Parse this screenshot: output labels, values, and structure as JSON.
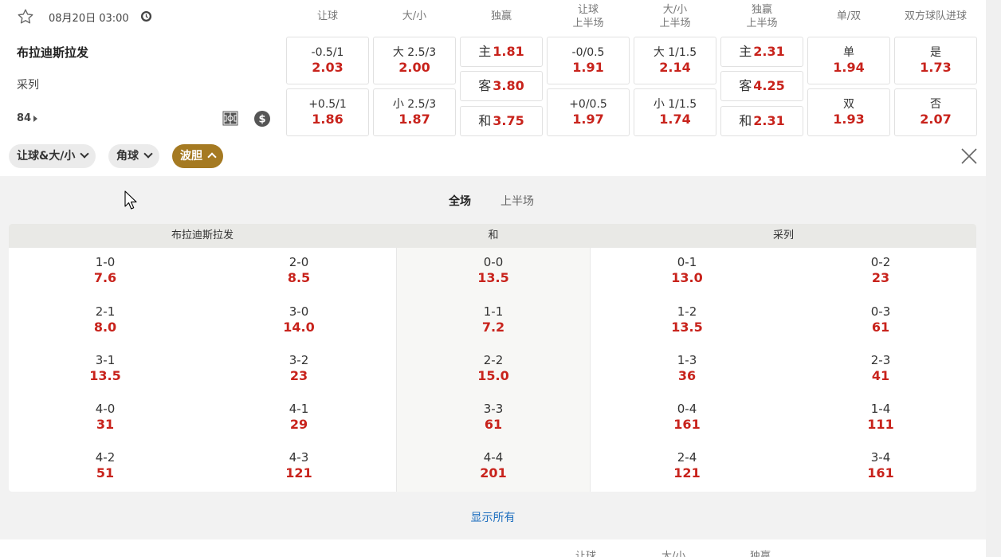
{
  "match": {
    "datetime": "08月20日 03:00",
    "home": "布拉迪斯拉发",
    "away": "采列",
    "more_count": "84"
  },
  "market_headers": [
    {
      "l1": "让球",
      "l2": ""
    },
    {
      "l1": "大/小",
      "l2": ""
    },
    {
      "l1": "独赢",
      "l2": ""
    },
    {
      "l1": "让球",
      "l2": "上半场"
    },
    {
      "l1": "大/小",
      "l2": "上半场"
    },
    {
      "l1": "独赢",
      "l2": "上半场"
    },
    {
      "l1": "单/双",
      "l2": ""
    },
    {
      "l1": "双方球队进球",
      "l2": ""
    }
  ],
  "markets": {
    "hdp": [
      {
        "label": "-0.5/1",
        "odd": "2.03"
      },
      {
        "label": "+0.5/1",
        "odd": "1.86"
      }
    ],
    "ou": [
      {
        "label": "大 2.5/3",
        "odd": "2.00"
      },
      {
        "label": "小 2.5/3",
        "odd": "1.87"
      }
    ],
    "x12": [
      {
        "label": "主",
        "odd": "1.81"
      },
      {
        "label": "客",
        "odd": "3.80"
      },
      {
        "label": "和",
        "odd": "3.75"
      }
    ],
    "hdp_h1": [
      {
        "label": "-0/0.5",
        "odd": "1.91"
      },
      {
        "label": "+0/0.5",
        "odd": "1.97"
      }
    ],
    "ou_h1": [
      {
        "label": "大 1/1.5",
        "odd": "2.14"
      },
      {
        "label": "小 1/1.5",
        "odd": "1.74"
      }
    ],
    "x12_h1": [
      {
        "label": "主",
        "odd": "2.31"
      },
      {
        "label": "客",
        "odd": "4.25"
      },
      {
        "label": "和",
        "odd": "2.31"
      }
    ],
    "oe": [
      {
        "label": "单",
        "odd": "1.94"
      },
      {
        "label": "双",
        "odd": "1.93"
      }
    ],
    "btts": [
      {
        "label": "是",
        "odd": "1.73"
      },
      {
        "label": "否",
        "odd": "2.07"
      }
    ]
  },
  "chips": [
    "让球&大/小",
    "角球",
    "波胆"
  ],
  "tabs": {
    "full": "全场",
    "half": "上半场"
  },
  "cs_headers": {
    "home": "布拉迪斯拉发",
    "draw": "和",
    "away": "采列"
  },
  "cs_rows": [
    [
      {
        "s": "1-0",
        "o": "7.6"
      },
      {
        "s": "2-0",
        "o": "8.5"
      },
      {
        "s": "0-0",
        "o": "13.5"
      },
      {
        "s": "0-1",
        "o": "13.0"
      },
      {
        "s": "0-2",
        "o": "23"
      }
    ],
    [
      {
        "s": "2-1",
        "o": "8.0"
      },
      {
        "s": "3-0",
        "o": "14.0"
      },
      {
        "s": "1-1",
        "o": "7.2"
      },
      {
        "s": "1-2",
        "o": "13.5"
      },
      {
        "s": "0-3",
        "o": "61"
      }
    ],
    [
      {
        "s": "3-1",
        "o": "13.5"
      },
      {
        "s": "3-2",
        "o": "23"
      },
      {
        "s": "2-2",
        "o": "15.0"
      },
      {
        "s": "1-3",
        "o": "36"
      },
      {
        "s": "2-3",
        "o": "41"
      }
    ],
    [
      {
        "s": "4-0",
        "o": "31"
      },
      {
        "s": "4-1",
        "o": "29"
      },
      {
        "s": "3-3",
        "o": "61"
      },
      {
        "s": "0-4",
        "o": "161"
      },
      {
        "s": "1-4",
        "o": "111"
      }
    ],
    [
      {
        "s": "4-2",
        "o": "51"
      },
      {
        "s": "4-3",
        "o": "121"
      },
      {
        "s": "4-4",
        "o": "201"
      },
      {
        "s": "2-4",
        "o": "121"
      },
      {
        "s": "3-4",
        "o": "161"
      }
    ]
  ],
  "show_all": "显示所有",
  "next_headers": [
    "让球",
    "大/小",
    "独赢"
  ],
  "colors": {
    "odds_red": "#c8231c",
    "accent_gold": "#a57a22",
    "link_blue": "#1e6fbf"
  }
}
